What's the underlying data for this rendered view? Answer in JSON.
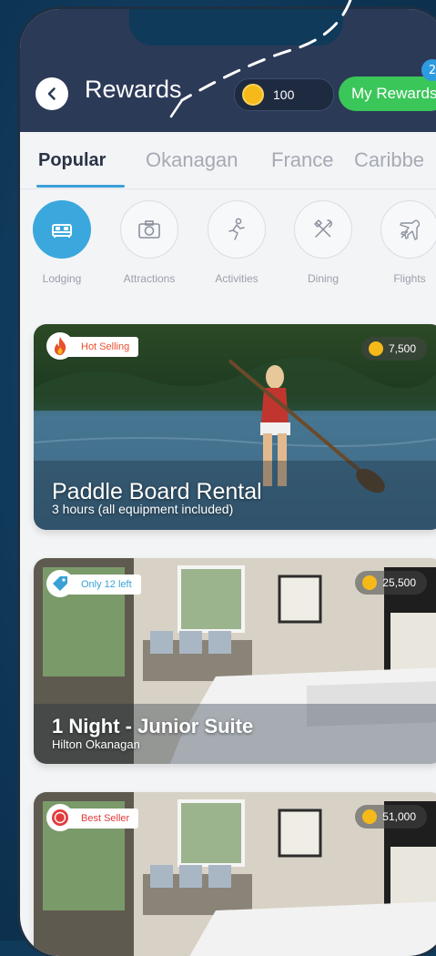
{
  "header": {
    "title": "Rewards",
    "coins": "100",
    "my_rewards_label": "My Rewards",
    "notification_count": "2"
  },
  "tabs": [
    {
      "label": "Popular",
      "active": true
    },
    {
      "label": "Okanagan"
    },
    {
      "label": "France"
    },
    {
      "label": "Caribbe"
    }
  ],
  "categories": [
    {
      "label": "Lodging",
      "icon": "bed-icon",
      "active": true
    },
    {
      "label": "Attractions",
      "icon": "camera-icon"
    },
    {
      "label": "Activities",
      "icon": "runner-icon"
    },
    {
      "label": "Dining",
      "icon": "fork-knife-icon"
    },
    {
      "label": "Flights",
      "icon": "airplane-icon"
    }
  ],
  "cards": [
    {
      "tag": "Hot Selling",
      "tag_icon": "fire-icon",
      "price": "7,500",
      "title": "Paddle Board Rental",
      "subtitle": "3 hours (all equipment included)"
    },
    {
      "tag": "Only 12 left",
      "tag_icon": "price-tag-icon",
      "price": "25,500",
      "title": "1 Night - Junior Suite",
      "subtitle": "Hilton Okanagan"
    },
    {
      "tag": "Best Seller",
      "tag_icon": "top-badge-icon",
      "price": "51,000",
      "title": "",
      "subtitle": ""
    }
  ],
  "colors": {
    "header_bg": "#2b3a57",
    "accent_blue": "#3aa8dc",
    "green": "#3bc65a",
    "coin": "#f6b91a",
    "page_bg": "#0f3a5a"
  }
}
